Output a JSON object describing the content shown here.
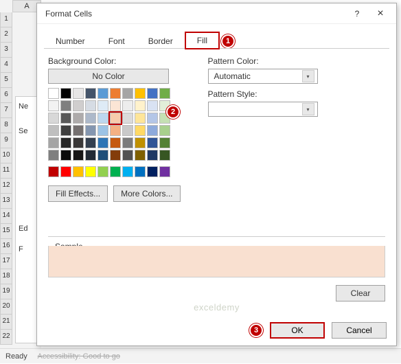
{
  "excel": {
    "col": "A",
    "rows": [
      "1",
      "2",
      "3",
      "4",
      "5",
      "6",
      "7",
      "8",
      "9",
      "10",
      "11",
      "12",
      "13",
      "14",
      "15",
      "16",
      "17",
      "18",
      "19",
      "20",
      "21",
      "22"
    ],
    "status": "Ready",
    "accessibility": "Accessibility: Good to go",
    "side": {
      "ne": "Ne",
      "se": "Se",
      "ed": "Ed",
      "f": "F"
    }
  },
  "dialog": {
    "title": "Format Cells",
    "help": "?",
    "close": "×",
    "tabs": {
      "number": "Number",
      "font": "Font",
      "border": "Border",
      "fill": "Fill"
    },
    "labels": {
      "bg": "Background Color:",
      "nocolor": "No Color",
      "patcolor": "Pattern Color:",
      "patstyle": "Pattern Style:",
      "auto": "Automatic",
      "effects": "Fill Effects...",
      "more": "More Colors...",
      "sample": "Sample",
      "clear": "Clear",
      "ok": "OK",
      "cancel": "Cancel"
    }
  },
  "badges": {
    "b1": "1",
    "b2": "2",
    "b3": "3"
  },
  "watermark": "exceldemy",
  "theme_colors": [
    [
      "#ffffff",
      "#000000",
      "#e7e6e6",
      "#44546a",
      "#5b9bd5",
      "#ed7d31",
      "#a5a5a5",
      "#ffc000",
      "#4472c4",
      "#70ad47"
    ],
    [
      "#f2f2f2",
      "#7f7f7f",
      "#d0cece",
      "#d6dce4",
      "#deebf6",
      "#fbe5d5",
      "#ededed",
      "#fff2cc",
      "#d9e2f3",
      "#e2efd9"
    ],
    [
      "#d8d8d8",
      "#595959",
      "#aeabab",
      "#adb9ca",
      "#bdd7ee",
      "#f7cbac",
      "#dbdbdb",
      "#fee599",
      "#b4c6e7",
      "#c5e0b3"
    ],
    [
      "#bfbfbf",
      "#3f3f3f",
      "#757070",
      "#8496b0",
      "#9cc3e5",
      "#f4b183",
      "#c9c9c9",
      "#ffd965",
      "#8eaadb",
      "#a8d08d"
    ],
    [
      "#a5a5a5",
      "#262626",
      "#3a3838",
      "#333f4f",
      "#2e75b5",
      "#c55a11",
      "#7b7b7b",
      "#bf9000",
      "#2f5496",
      "#538135"
    ],
    [
      "#7f7f7f",
      "#0c0c0c",
      "#171616",
      "#222a35",
      "#1e4e79",
      "#833c0b",
      "#525252",
      "#7f6000",
      "#1f3864",
      "#375623"
    ]
  ],
  "standard_colors": [
    "#c00000",
    "#ff0000",
    "#ffc000",
    "#ffff00",
    "#92d050",
    "#00b050",
    "#00b0f0",
    "#0070c0",
    "#002060",
    "#7030a0"
  ],
  "selected_swatch": "#f7cbac"
}
